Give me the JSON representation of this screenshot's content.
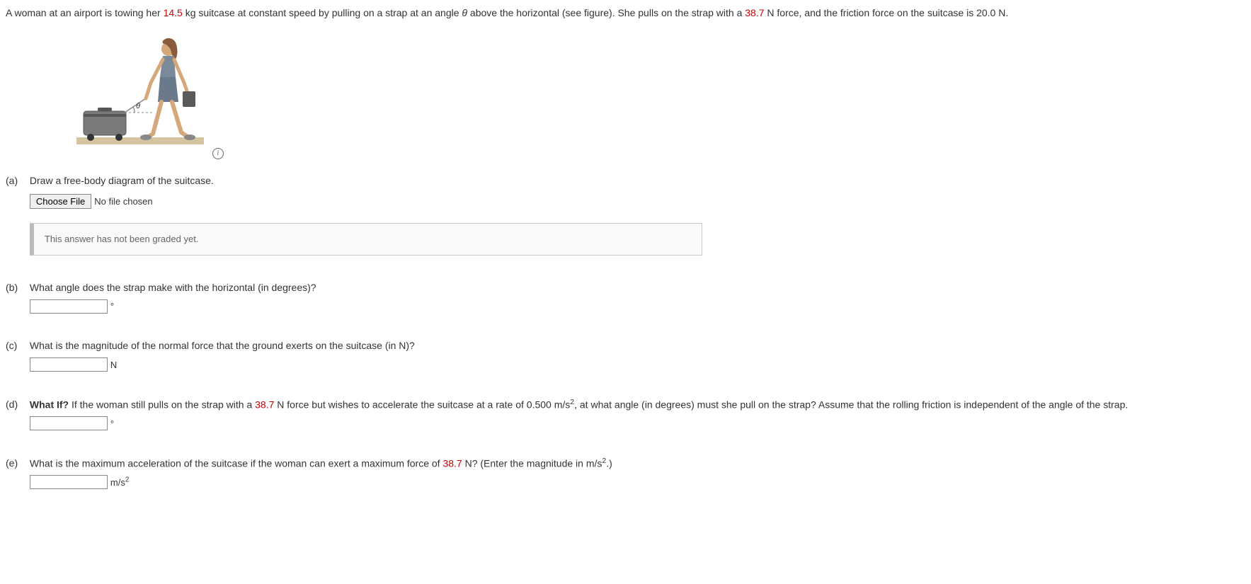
{
  "intro": {
    "text1": "A woman at an airport is towing her ",
    "mass": "14.5",
    "text2": " kg suitcase at constant speed by pulling on a strap at an angle ",
    "theta": "θ",
    "text3": " above the horizontal (see figure). She pulls on the strap with a ",
    "force": "38.7",
    "text4": " N force, and the friction force on the suitcase is 20.0 N."
  },
  "parts": {
    "a": {
      "label": "(a)",
      "question": "Draw a free-body diagram of the suitcase.",
      "chooseFile": "Choose File",
      "noFile": "No file chosen",
      "ungraded": "This answer has not been graded yet."
    },
    "b": {
      "label": "(b)",
      "question": "What angle does the strap make with the horizontal (in degrees)?",
      "unit": "°"
    },
    "c": {
      "label": "(c)",
      "question": "What is the magnitude of the normal force that the ground exerts on the suitcase (in N)?",
      "unit": "N"
    },
    "d": {
      "label": "(d)",
      "whatIf": "What If?",
      "text1": " If the woman still pulls on the strap with a ",
      "force": "38.7",
      "text2": " N force but wishes to accelerate the suitcase at a rate of 0.500 m/s",
      "exp": "2",
      "text3": ", at what angle (in degrees) must she pull on the strap? Assume that the rolling friction is independent of the angle of the strap.",
      "unit": "°"
    },
    "e": {
      "label": "(e)",
      "text1": "What is the maximum acceleration of the suitcase if the woman can exert a maximum force of ",
      "force": "38.7",
      "text2": " N? (Enter the magnitude in m/s",
      "exp1": "2",
      "text3": ".)",
      "unit1": "m/s",
      "exp2": "2"
    }
  },
  "infoIcon": "i"
}
